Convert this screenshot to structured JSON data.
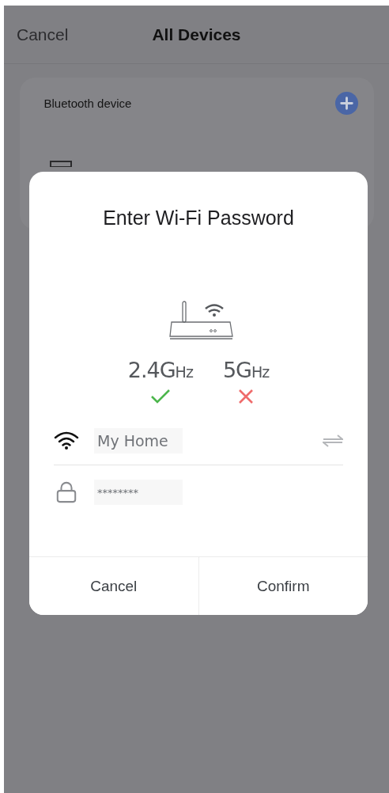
{
  "nav": {
    "back": "Cancel",
    "title": "All Devices"
  },
  "card": {
    "label": "Bluetooth device"
  },
  "dialog": {
    "title": "Enter Wi-Fi Password",
    "bands": [
      {
        "label": "2.4G",
        "unit": "Hz",
        "supported": true
      },
      {
        "label": "5G",
        "unit": "Hz",
        "supported": false
      }
    ],
    "network": {
      "value": "My Home"
    },
    "password": {
      "value": "********"
    },
    "buttons": [
      "Cancel",
      "Confirm"
    ]
  }
}
